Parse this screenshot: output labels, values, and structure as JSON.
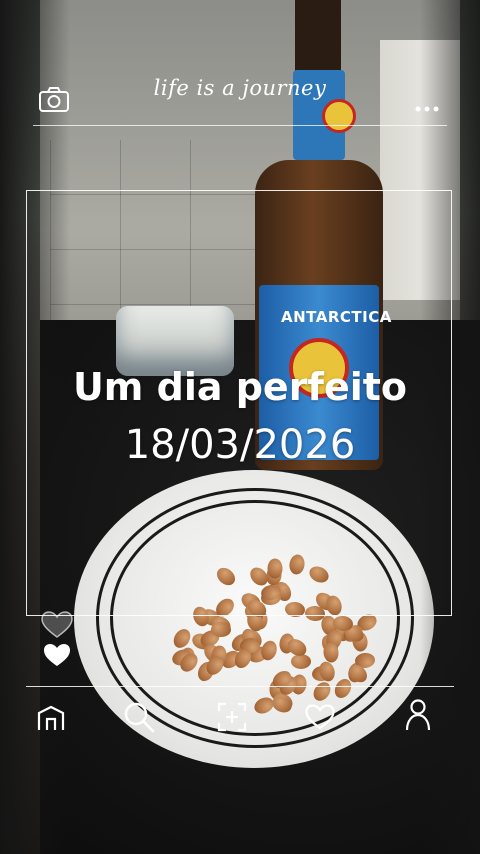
{
  "header": {
    "brand": "life is a journey",
    "camera_icon": "camera-icon",
    "more_icon": "more-dots-icon"
  },
  "content": {
    "title": "Um dia perfeito",
    "date": "18/03/2026"
  },
  "side": {
    "like_icons": [
      "heart-outline-icon",
      "heart-filled-icon"
    ]
  },
  "bottom_nav": {
    "items": [
      {
        "icon": "home-icon"
      },
      {
        "icon": "search-icon"
      },
      {
        "icon": "add-photo-icon"
      },
      {
        "icon": "heart-icon"
      },
      {
        "icon": "profile-icon"
      }
    ]
  },
  "photo": {
    "bottle_label": "ANTARCTICA"
  },
  "colors": {
    "overlay": "#ffffff",
    "label_blue": "#2d76b8"
  }
}
